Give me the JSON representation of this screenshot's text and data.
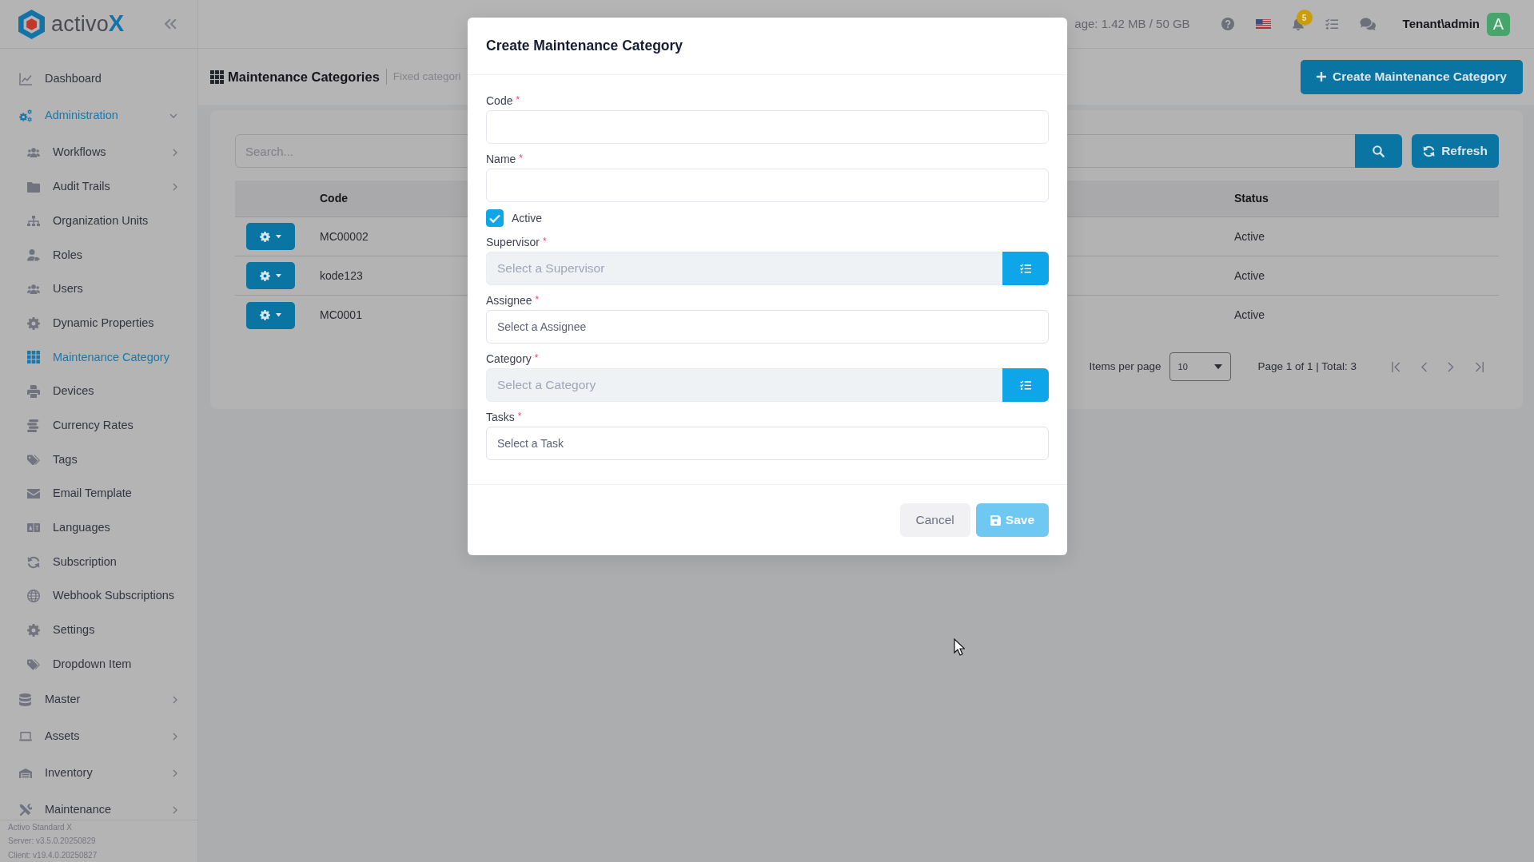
{
  "logo": {
    "text": "activo",
    "accent": "X"
  },
  "topbar": {
    "storage": "age: 1.42 MB / 50 GB",
    "notifications": "5",
    "user": "Tenant\\admin",
    "avatar": "A"
  },
  "sidebar": {
    "items": [
      {
        "label": "Dashboard",
        "kind": "link",
        "selected": false
      },
      {
        "label": "Administration",
        "kind": "group",
        "selected": true,
        "expanded": true,
        "children": [
          {
            "label": "Workflows",
            "kind": "group",
            "selected": false,
            "expanded": false
          },
          {
            "label": "Audit Trails",
            "kind": "group",
            "selected": false,
            "expanded": false
          },
          {
            "label": "Organization Units",
            "kind": "link",
            "selected": false
          },
          {
            "label": "Roles",
            "kind": "link",
            "selected": false
          },
          {
            "label": "Users",
            "kind": "link",
            "selected": false
          },
          {
            "label": "Dynamic Properties",
            "kind": "link",
            "selected": false
          },
          {
            "label": "Maintenance Category",
            "kind": "link",
            "selected": true
          },
          {
            "label": "Devices",
            "kind": "link",
            "selected": false
          },
          {
            "label": "Currency Rates",
            "kind": "link",
            "selected": false
          },
          {
            "label": "Tags",
            "kind": "link",
            "selected": false
          },
          {
            "label": "Email Template",
            "kind": "link",
            "selected": false
          },
          {
            "label": "Languages",
            "kind": "link",
            "selected": false
          },
          {
            "label": "Subscription",
            "kind": "link",
            "selected": false
          },
          {
            "label": "Webhook Subscriptions",
            "kind": "link",
            "selected": false
          },
          {
            "label": "Settings",
            "kind": "link",
            "selected": false
          },
          {
            "label": "Dropdown Item",
            "kind": "link",
            "selected": false
          }
        ]
      },
      {
        "label": "Master",
        "kind": "group",
        "selected": false,
        "expanded": false
      },
      {
        "label": "Assets",
        "kind": "group",
        "selected": false,
        "expanded": false
      },
      {
        "label": "Inventory",
        "kind": "group",
        "selected": false,
        "expanded": false
      },
      {
        "label": "Maintenance",
        "kind": "group",
        "selected": false,
        "expanded": false
      }
    ],
    "footer": [
      "Activo Standard X",
      "Server: v3.5.0.20250829",
      "Client: v19.4.0.20250827"
    ]
  },
  "page_header": {
    "title": "Maintenance Categories",
    "subtitle": "Fixed categori",
    "create_button": "Create Maintenance Category"
  },
  "toolbar": {
    "search": {
      "placeholder": "Search..."
    },
    "refresh_button": "Refresh"
  },
  "table": {
    "columns": [
      "Code",
      "Status"
    ],
    "rows": [
      {
        "cells": [
          "MC00002",
          "Active"
        ]
      },
      {
        "cells": [
          "kode123",
          "Active"
        ]
      },
      {
        "cells": [
          "MC0001",
          "Active"
        ]
      }
    ]
  },
  "pagination": {
    "items_per_page_label": "Items per page",
    "page_size": "10",
    "summary": "Page 1 of 1 | Total: 3"
  },
  "modal": {
    "title": "Create Maintenance Category",
    "fields": [
      {
        "kind": "text",
        "label": "Code",
        "required_mark": "*"
      },
      {
        "kind": "text",
        "label": "Name",
        "required_mark": "*"
      },
      {
        "kind": "checkbox",
        "label": "Active",
        "checked": true
      },
      {
        "kind": "lookup",
        "label": "Supervisor",
        "required_mark": "*",
        "placeholder": "Select a Supervisor"
      },
      {
        "kind": "select",
        "label": "Assignee",
        "required_mark": "*",
        "placeholder": "Select a Assignee"
      },
      {
        "kind": "lookup",
        "label": "Category",
        "required_mark": "*",
        "placeholder": "Select a Category"
      },
      {
        "kind": "select",
        "label": "Tasks",
        "required_mark": "*",
        "placeholder": "Select a Task"
      }
    ],
    "buttons": [
      {
        "label": "Cancel",
        "kind": "secondary",
        "disabled": false
      },
      {
        "label": "Save",
        "kind": "primary",
        "disabled": true
      }
    ]
  }
}
